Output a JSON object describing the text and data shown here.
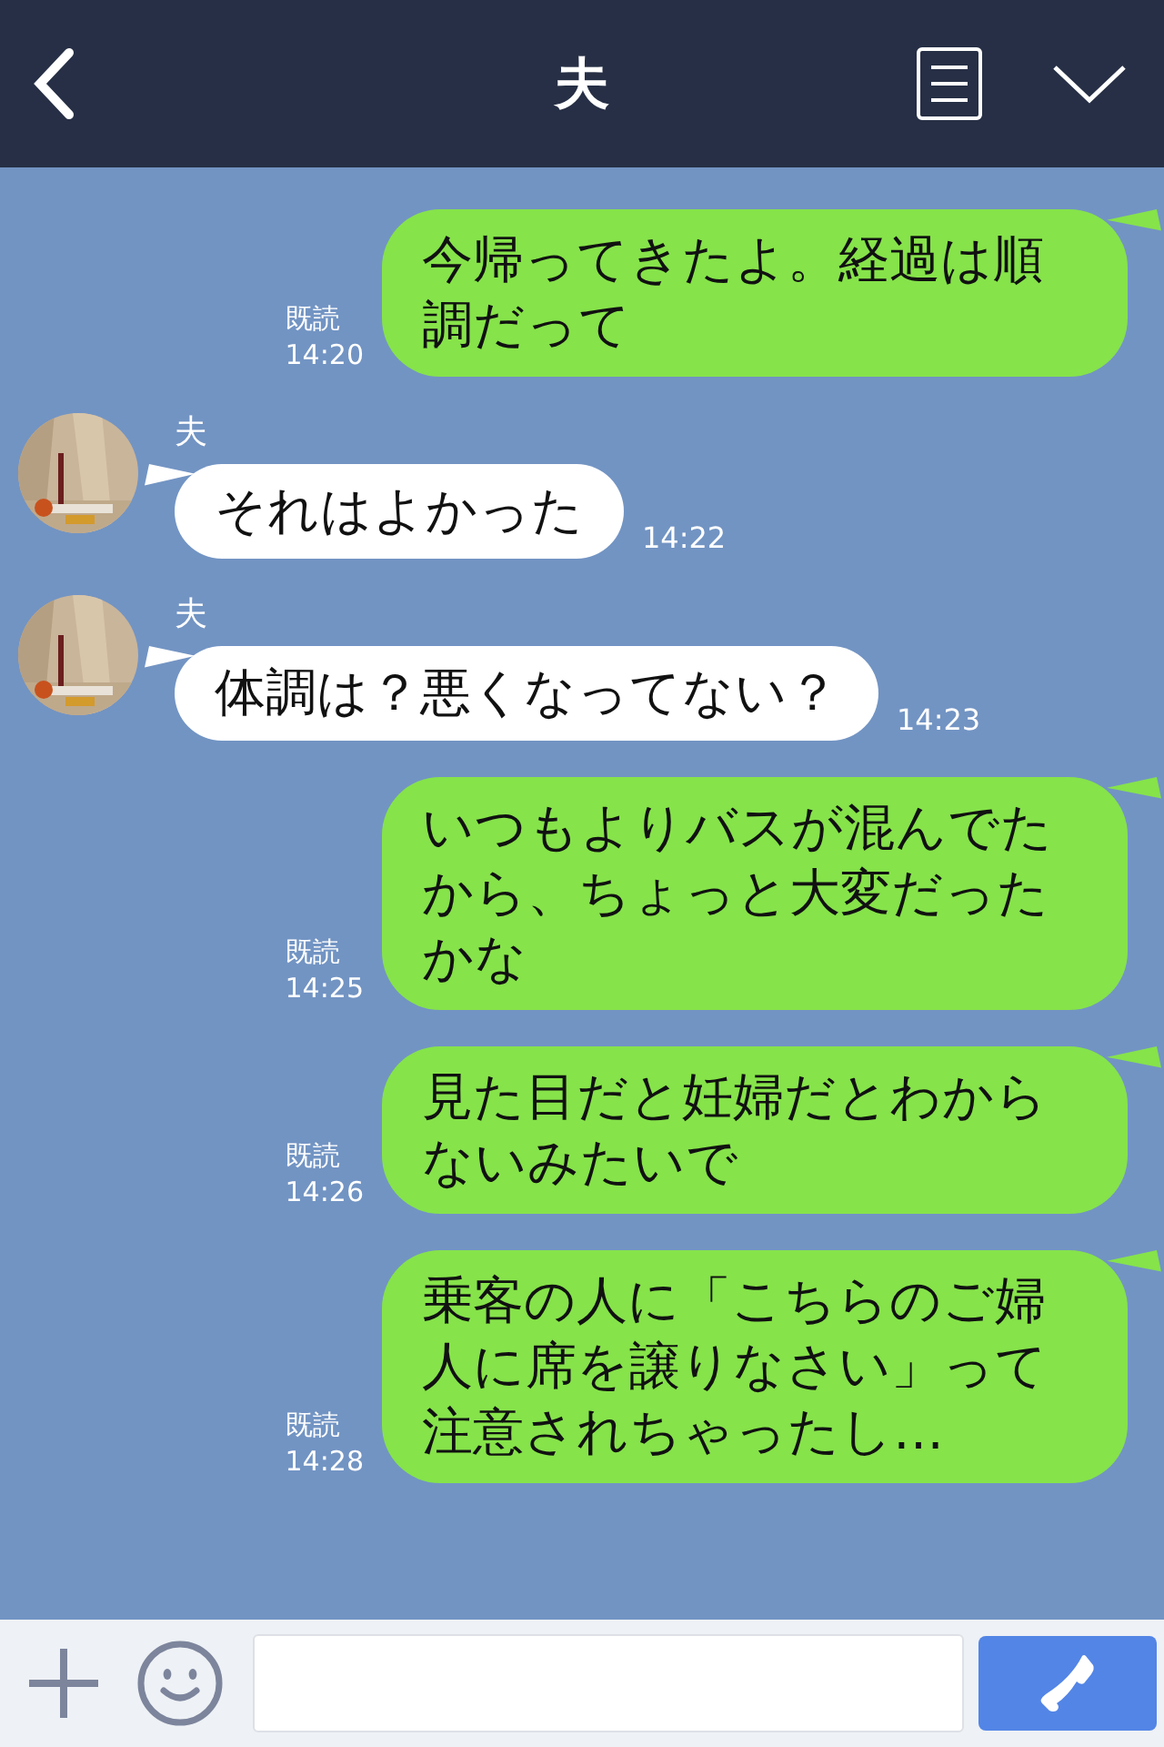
{
  "header": {
    "title": "夫"
  },
  "messages": [
    {
      "kind": "sent",
      "text": "今帰ってきたよ。経過は順調だって",
      "read": "既読",
      "time": "14:20"
    },
    {
      "kind": "received",
      "sender": "夫",
      "text": "それはよかった",
      "time": "14:22"
    },
    {
      "kind": "received",
      "sender": "夫",
      "text": "体調は？悪くなってない？",
      "time": "14:23"
    },
    {
      "kind": "sent",
      "text": "いつもよりバスが混んでたから、ちょっと大変だったかな",
      "read": "既読",
      "time": "14:25"
    },
    {
      "kind": "sent",
      "text": "見た目だと妊婦だとわからないみたいで",
      "read": "既読",
      "time": "14:26"
    },
    {
      "kind": "sent",
      "text": "乗客の人に「こちらのご婦人に席を譲りなさい」って注意されちゃったし…",
      "read": "既読",
      "time": "14:28"
    }
  ]
}
